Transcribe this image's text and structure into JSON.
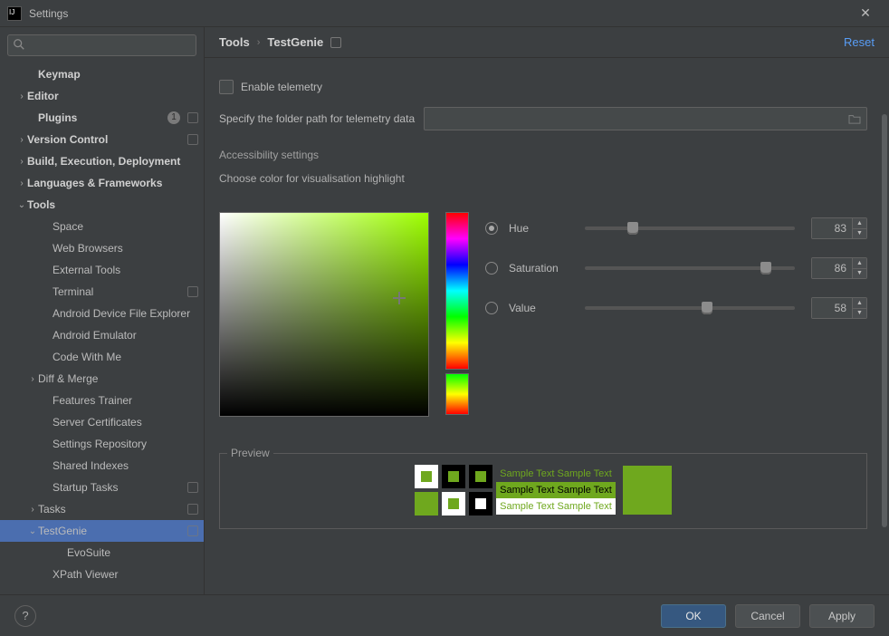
{
  "window": {
    "title": "Settings"
  },
  "search": {
    "placeholder": ""
  },
  "sidebar": {
    "items": [
      {
        "label": "Keymap",
        "indent": 1,
        "bold": true
      },
      {
        "label": "Editor",
        "indent": 0,
        "bold": true,
        "chev": "right",
        "marker": false
      },
      {
        "label": "Plugins",
        "indent": 1,
        "bold": true,
        "badge": "1",
        "marker": true
      },
      {
        "label": "Version Control",
        "indent": 0,
        "bold": true,
        "chev": "right",
        "marker": true
      },
      {
        "label": "Build, Execution, Deployment",
        "indent": 0,
        "bold": true,
        "chev": "right"
      },
      {
        "label": "Languages & Frameworks",
        "indent": 0,
        "bold": true,
        "chev": "right"
      },
      {
        "label": "Tools",
        "indent": 0,
        "bold": true,
        "chev": "down"
      },
      {
        "label": "Space",
        "indent": 2
      },
      {
        "label": "Web Browsers",
        "indent": 2
      },
      {
        "label": "External Tools",
        "indent": 2
      },
      {
        "label": "Terminal",
        "indent": 2,
        "marker": true
      },
      {
        "label": "Android Device File Explorer",
        "indent": 2
      },
      {
        "label": "Android Emulator",
        "indent": 2
      },
      {
        "label": "Code With Me",
        "indent": 2
      },
      {
        "label": "Diff & Merge",
        "indent": 1,
        "chev": "right"
      },
      {
        "label": "Features Trainer",
        "indent": 2
      },
      {
        "label": "Server Certificates",
        "indent": 2
      },
      {
        "label": "Settings Repository",
        "indent": 2
      },
      {
        "label": "Shared Indexes",
        "indent": 2
      },
      {
        "label": "Startup Tasks",
        "indent": 2,
        "marker": true
      },
      {
        "label": "Tasks",
        "indent": 1,
        "chev": "right",
        "marker": true
      },
      {
        "label": "TestGenie",
        "indent": 1,
        "chev": "down",
        "marker": true,
        "selected": true
      },
      {
        "label": "EvoSuite",
        "indent": 3
      },
      {
        "label": "XPath Viewer",
        "indent": 2
      }
    ]
  },
  "breadcrumb": {
    "a": "Tools",
    "b": "TestGenie",
    "reset": "Reset"
  },
  "telemetry": {
    "enable_label": "Enable telemetry",
    "path_label": "Specify the folder path for telemetry data",
    "path_value": ""
  },
  "accessibility": {
    "title": "Accessibility settings",
    "subtitle": "Choose color for visualisation highlight"
  },
  "hsv": {
    "hue": {
      "label": "Hue",
      "value": "83",
      "pos": 23,
      "selected": true
    },
    "saturation": {
      "label": "Saturation",
      "value": "86",
      "pos": 86,
      "selected": false
    },
    "value": {
      "label": "Value",
      "value": "58",
      "pos": 58,
      "selected": false
    }
  },
  "preview": {
    "legend": "Preview",
    "sample": "Sample Text",
    "color": "#6fa81e"
  },
  "footer": {
    "ok": "OK",
    "cancel": "Cancel",
    "apply": "Apply"
  }
}
